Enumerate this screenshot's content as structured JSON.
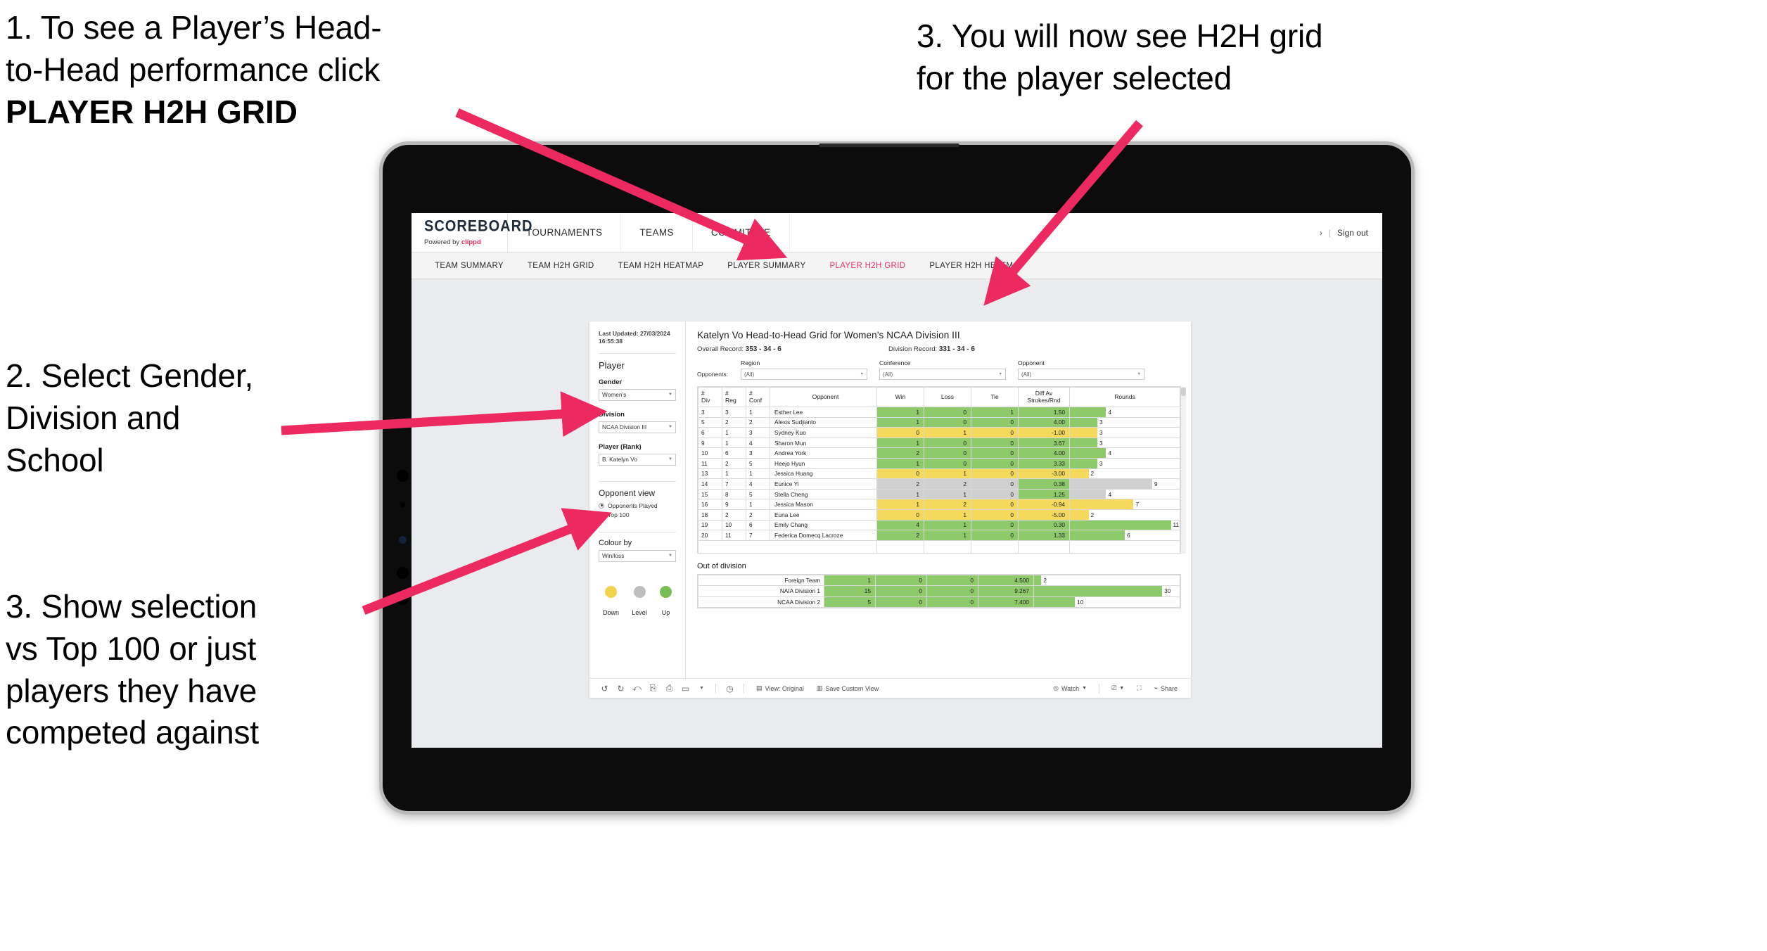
{
  "annotations": {
    "a1_line1": "1. To see a Player’s Head-",
    "a1_line2": "to-Head performance click",
    "a1_bold": "PLAYER H2H GRID",
    "a2": "2. Select Gender,\nDivision and\nSchool",
    "a3": "3. Show selection\nvs Top 100 or just\nplayers they have\ncompeted against",
    "a4": "3. You will now see H2H grid\nfor the player selected",
    "arrow_color": "#ec2a60"
  },
  "app": {
    "brand_logo": "SCOREBOARD",
    "brand_tag_prefix": "Powered by ",
    "brand_tag_accent": "clippd",
    "top_nav": [
      "TOURNAMENTS",
      "TEAMS",
      "COMMITTEE"
    ],
    "user_chevron": "›",
    "separator": "|",
    "sign_out": "Sign out",
    "sub_nav": [
      {
        "label": "TEAM SUMMARY",
        "active": false
      },
      {
        "label": "TEAM H2H GRID",
        "active": false
      },
      {
        "label": "TEAM H2H HEATMAP",
        "active": false
      },
      {
        "label": "PLAYER SUMMARY",
        "active": false
      },
      {
        "label": "PLAYER H2H GRID",
        "active": true
      },
      {
        "label": "PLAYER H2H HEATMAP",
        "active": false
      }
    ],
    "active_color": "#ec2f62"
  },
  "filters": {
    "last_updated": "Last Updated: 27/03/2024 16:55:38",
    "section_title": "Player",
    "gender": {
      "label": "Gender",
      "value": "Women’s"
    },
    "division": {
      "label": "Division",
      "value": "NCAA Division III"
    },
    "player": {
      "label": "Player (Rank)",
      "value": "B. Katelyn Vo"
    },
    "opponent_view": {
      "title": "Opponent view",
      "options": [
        {
          "label": "Opponents Played",
          "selected": true
        },
        {
          "label": "Top 100",
          "selected": false
        }
      ]
    },
    "colour_by": {
      "label": "Colour by",
      "value": "Win/loss"
    },
    "legend": [
      {
        "label": "Down",
        "color": "#f2d24b"
      },
      {
        "label": "Level",
        "color": "#bdbdbd"
      },
      {
        "label": "Up",
        "color": "#79bd52"
      }
    ]
  },
  "viz": {
    "title": "Katelyn Vo Head-to-Head Grid for Women’s NCAA Division III",
    "overall_record_label": "Overall Record:",
    "overall_record_value": "353 - 34 - 6",
    "division_record_label": "Division Record:",
    "division_record_value": "331 - 34 - 6",
    "opponents_label": "Opponents:",
    "opponent_filters": [
      {
        "label": "Region",
        "value": "(All)"
      },
      {
        "label": "Conference",
        "value": "(All)"
      },
      {
        "label": "Opponent",
        "value": "(All)"
      }
    ],
    "columns": [
      "# Div",
      "# Reg",
      "# Conf",
      "Opponent",
      "Win",
      "Loss",
      "Tie",
      "Diff Av Strokes/Rnd",
      "Rounds"
    ],
    "column_head_lines": [
      [
        "#",
        "Div"
      ],
      [
        "#",
        "Reg"
      ],
      [
        "#",
        "Conf"
      ],
      [
        "Opponent",
        ""
      ],
      [
        "Win",
        ""
      ],
      [
        "Loss",
        ""
      ],
      [
        "Tie",
        ""
      ],
      [
        "Diff Av",
        "Strokes/Rnd"
      ],
      [
        "Rounds",
        ""
      ]
    ],
    "rows": [
      {
        "div": "3",
        "reg": "3",
        "conf": "1",
        "opponent": "Esther Lee",
        "win": "1",
        "loss": "0",
        "tie": "1",
        "diff": "1.50",
        "rounds": "4",
        "color": "#8ec96a",
        "bar_pct": 33
      },
      {
        "div": "5",
        "reg": "2",
        "conf": "2",
        "opponent": "Alexis Sudjianto",
        "win": "1",
        "loss": "0",
        "tie": "0",
        "diff": "4.00",
        "rounds": "3",
        "color": "#8ec96a",
        "bar_pct": 25
      },
      {
        "div": "6",
        "reg": "1",
        "conf": "3",
        "opponent": "Sydney Kuo",
        "win": "0",
        "loss": "1",
        "tie": "0",
        "diff": "-1.00",
        "rounds": "3",
        "color": "#f4d95c",
        "bar_pct": 25
      },
      {
        "div": "9",
        "reg": "1",
        "conf": "4",
        "opponent": "Sharon Mun",
        "win": "1",
        "loss": "0",
        "tie": "0",
        "diff": "3.67",
        "rounds": "3",
        "color": "#8ec96a",
        "bar_pct": 25
      },
      {
        "div": "10",
        "reg": "6",
        "conf": "3",
        "opponent": "Andrea York",
        "win": "2",
        "loss": "0",
        "tie": "0",
        "diff": "4.00",
        "rounds": "4",
        "color": "#8ec96a",
        "bar_pct": 33
      },
      {
        "div": "11",
        "reg": "2",
        "conf": "5",
        "opponent": "Heejo Hyun",
        "win": "1",
        "loss": "0",
        "tie": "0",
        "diff": "3.33",
        "rounds": "3",
        "color": "#8ec96a",
        "bar_pct": 25
      },
      {
        "div": "13",
        "reg": "1",
        "conf": "1",
        "opponent": "Jessica Huang",
        "win": "0",
        "loss": "1",
        "tie": "0",
        "diff": "-3.00",
        "rounds": "2",
        "color": "#f4d95c",
        "bar_pct": 17
      },
      {
        "div": "14",
        "reg": "7",
        "conf": "4",
        "opponent": "Eunice Yi",
        "win": "2",
        "loss": "2",
        "tie": "0",
        "diff": "0.38",
        "rounds": "9",
        "color": "#d0d0d0",
        "bar_pct": 75,
        "diff_color": "#8ec96a"
      },
      {
        "div": "15",
        "reg": "8",
        "conf": "5",
        "opponent": "Stella Cheng",
        "win": "1",
        "loss": "1",
        "tie": "0",
        "diff": "1.25",
        "rounds": "4",
        "color": "#d0d0d0",
        "bar_pct": 33,
        "diff_color": "#8ec96a"
      },
      {
        "div": "16",
        "reg": "9",
        "conf": "1",
        "opponent": "Jessica Mason",
        "win": "1",
        "loss": "2",
        "tie": "0",
        "diff": "-0.94",
        "rounds": "7",
        "color": "#f4d95c",
        "bar_pct": 58
      },
      {
        "div": "18",
        "reg": "2",
        "conf": "2",
        "opponent": "Euna Lee",
        "win": "0",
        "loss": "1",
        "tie": "0",
        "diff": "-5.00",
        "rounds": "2",
        "color": "#f4d95c",
        "bar_pct": 17
      },
      {
        "div": "19",
        "reg": "10",
        "conf": "6",
        "opponent": "Emily Chang",
        "win": "4",
        "loss": "1",
        "tie": "0",
        "diff": "0.30",
        "rounds": "11",
        "color": "#8ec96a",
        "bar_pct": 92
      },
      {
        "div": "20",
        "reg": "11",
        "conf": "7",
        "opponent": "Federica Domecq Lacroze",
        "win": "2",
        "loss": "1",
        "tie": "0",
        "diff": "1.33",
        "rounds": "6",
        "color": "#8ec96a",
        "bar_pct": 50
      }
    ],
    "out_of_division_title": "Out of division",
    "out_of_division_rows": [
      {
        "name": "Foreign Team",
        "win": "1",
        "loss": "0",
        "tie": "0",
        "diff": "4.500",
        "rounds": "2",
        "color": "#8ec96a",
        "bar_pct": 5
      },
      {
        "name": "NAIA Division 1",
        "win": "15",
        "loss": "0",
        "tie": "0",
        "diff": "9.267",
        "rounds": "30",
        "color": "#8ec96a",
        "bar_pct": 88
      },
      {
        "name": "NCAA Division 2",
        "win": "5",
        "loss": "0",
        "tie": "0",
        "diff": "7.400",
        "rounds": "10",
        "color": "#8ec96a",
        "bar_pct": 28
      }
    ]
  },
  "toolbar": {
    "icons": [
      "undo-icon",
      "redo-icon",
      "revert-icon",
      "refresh-icon",
      "pause-icon",
      "alerts-icon",
      "dropdown-caret-icon",
      "subscribe-icon"
    ],
    "view_original": "View: Original",
    "save_custom_view": "Save Custom View",
    "watch": "Watch",
    "share": "Share"
  },
  "chart_data": {
    "type": "table",
    "title": "Katelyn Vo Head-to-Head Grid for Women’s NCAA Division III",
    "categories": [
      "Esther Lee",
      "Alexis Sudjianto",
      "Sydney Kuo",
      "Sharon Mun",
      "Andrea York",
      "Heejo Hyun",
      "Jessica Huang",
      "Eunice Yi",
      "Stella Cheng",
      "Jessica Mason",
      "Euna Lee",
      "Emily Chang",
      "Federica Domecq Lacroze"
    ],
    "series": [
      {
        "name": "Win",
        "values": [
          1,
          1,
          0,
          1,
          2,
          1,
          0,
          2,
          1,
          1,
          0,
          4,
          2
        ]
      },
      {
        "name": "Loss",
        "values": [
          0,
          0,
          1,
          0,
          0,
          0,
          1,
          2,
          1,
          2,
          1,
          1,
          1
        ]
      },
      {
        "name": "Tie",
        "values": [
          1,
          0,
          0,
          0,
          0,
          0,
          0,
          0,
          0,
          0,
          0,
          0,
          0
        ]
      },
      {
        "name": "Diff Av Strokes/Rnd",
        "values": [
          1.5,
          4.0,
          -1.0,
          3.67,
          4.0,
          3.33,
          -3.0,
          0.38,
          1.25,
          -0.94,
          -5.0,
          0.3,
          1.33
        ]
      },
      {
        "name": "Rounds",
        "values": [
          4,
          3,
          3,
          3,
          4,
          3,
          2,
          9,
          4,
          7,
          2,
          11,
          6
        ]
      }
    ],
    "xlabel": "Opponent",
    "ylabel": "",
    "legend_position": "left-panel",
    "grid": true
  }
}
